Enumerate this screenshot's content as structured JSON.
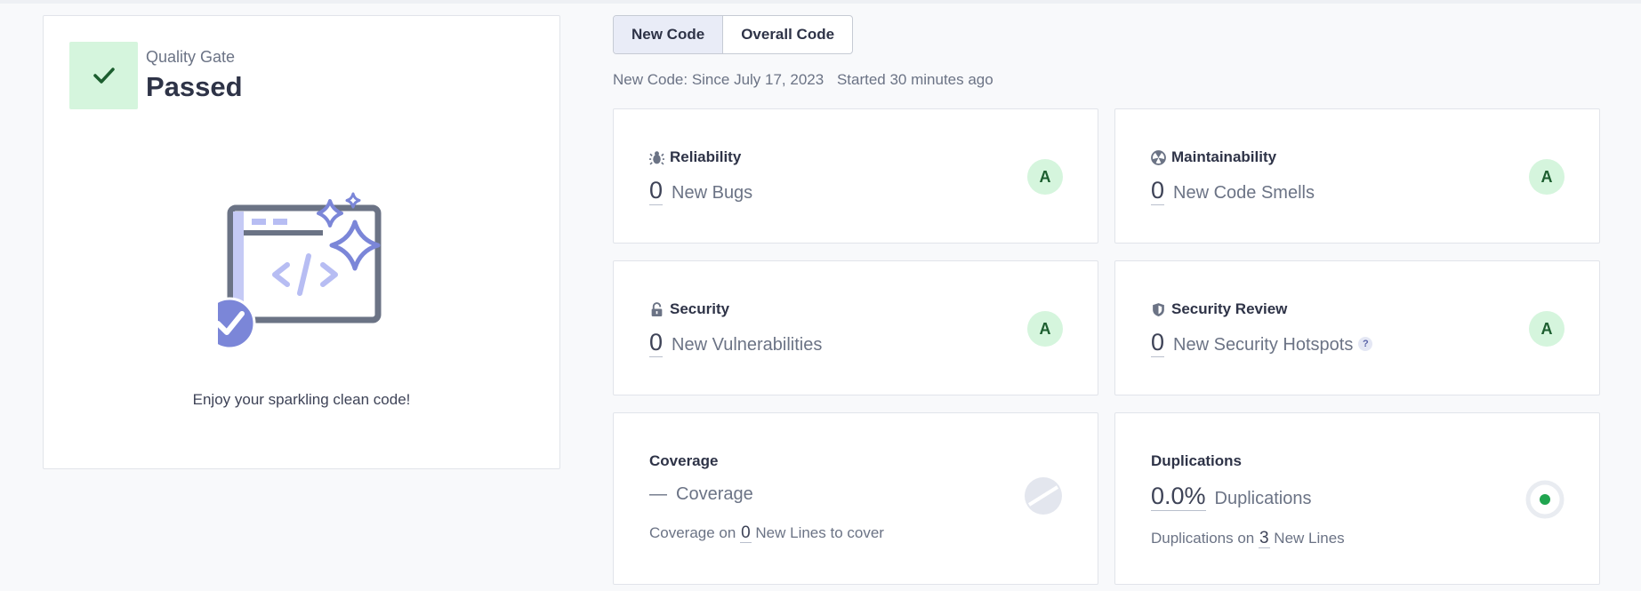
{
  "quality_gate": {
    "label": "Quality Gate",
    "status": "Passed",
    "message": "Enjoy your sparkling clean code!",
    "illustration_icon": "sparkling-code-illustration",
    "status_icon": "check-icon"
  },
  "toggle": {
    "new_code": "New Code",
    "overall_code": "Overall Code",
    "active": "New Code"
  },
  "meta": {
    "since": "New Code: Since July 17, 2023",
    "started": "Started 30 minutes ago"
  },
  "metrics": {
    "reliability": {
      "title": "Reliability",
      "icon": "bug-icon",
      "value": "0",
      "label": "New Bugs",
      "rating": "A"
    },
    "maintainability": {
      "title": "Maintainability",
      "icon": "code-smell-icon",
      "value": "0",
      "label": "New Code Smells",
      "rating": "A"
    },
    "security": {
      "title": "Security",
      "icon": "lock-icon",
      "value": "0",
      "label": "New Vulnerabilities",
      "rating": "A"
    },
    "security_review": {
      "title": "Security Review",
      "icon": "shield-icon",
      "value": "0",
      "label": "New Security Hotspots",
      "help": "?",
      "rating": "A"
    },
    "coverage": {
      "title": "Coverage",
      "value": "—",
      "label": "Coverage",
      "sub_prefix": "Coverage on",
      "sub_value": "0",
      "sub_suffix": "New Lines to cover"
    },
    "duplications": {
      "title": "Duplications",
      "value": "0.0%",
      "label": "Duplications",
      "sub_prefix": "Duplications on",
      "sub_value": "3",
      "sub_suffix": "New Lines"
    }
  },
  "colors": {
    "rating_bg": "#d5f5dd",
    "rating_text": "#1c5e2f",
    "accent": "#7b86d8",
    "duplication_dot": "#21a550"
  }
}
